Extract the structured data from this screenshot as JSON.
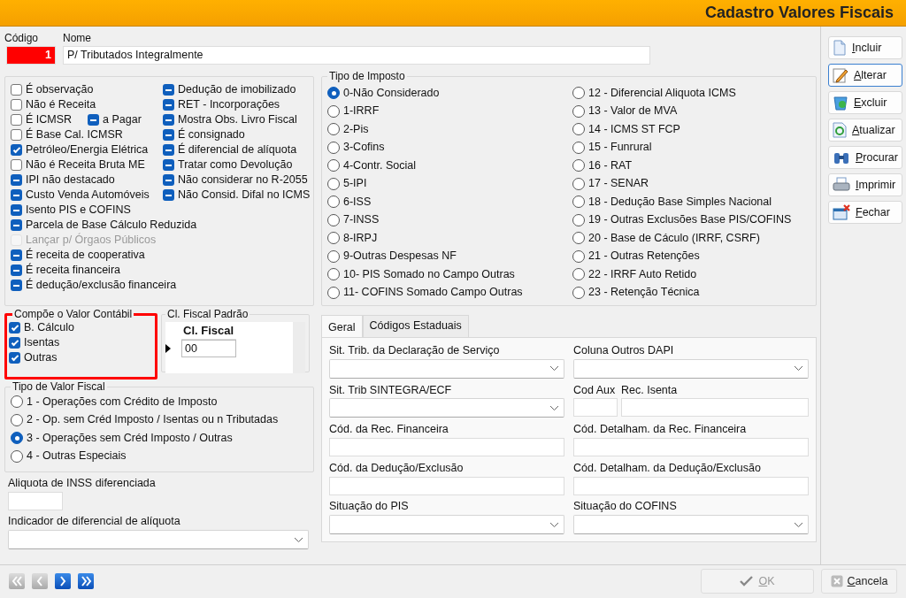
{
  "window": {
    "title": "Cadastro Valores Fiscais"
  },
  "codigo": {
    "label": "Código",
    "value": "1"
  },
  "nome": {
    "label": "Nome",
    "value": "P/ Tributados Integralmente"
  },
  "flags": {
    "column_1": [
      {
        "label": "É observação",
        "checked": false,
        "disabled": false
      },
      {
        "label": "Não é Receita",
        "checked": false,
        "disabled": false
      },
      {
        "label": "É ICMSR",
        "checked": false,
        "disabled": false,
        "inline": {
          "label": "a Pagar",
          "checked": true,
          "indeterminate": true
        }
      },
      {
        "label": "É Base Cal. ICMSR",
        "checked": false,
        "disabled": false
      },
      {
        "label": "Petróleo/Energia Elétrica",
        "checked": true,
        "disabled": false
      },
      {
        "label": "Não é Receita Bruta ME",
        "checked": false,
        "disabled": false
      },
      {
        "label": "IPI não destacado",
        "checked": true,
        "indeterminate": true,
        "disabled": false
      },
      {
        "label": "Custo Venda Automóveis",
        "checked": true,
        "indeterminate": true,
        "disabled": false
      },
      {
        "label": "Isento PIS e COFINS",
        "checked": true,
        "indeterminate": true,
        "disabled": false
      },
      {
        "label": "Parcela de Base Cálculo Reduzida",
        "checked": true,
        "indeterminate": true,
        "disabled": false
      },
      {
        "label": "Lançar p/ Órgaos Públicos",
        "checked": false,
        "disabled": true
      },
      {
        "label": "É receita de cooperativa",
        "checked": true,
        "indeterminate": true,
        "disabled": false
      },
      {
        "label": "É receita financeira",
        "checked": true,
        "indeterminate": true,
        "disabled": false
      },
      {
        "label": "É dedução/exclusão financeira",
        "checked": true,
        "indeterminate": true,
        "disabled": false
      }
    ],
    "column_2": [
      {
        "label": "Dedução de imobilizado",
        "checked": true,
        "indeterminate": true,
        "disabled": false
      },
      {
        "label": "RET - Incorporações",
        "checked": true,
        "indeterminate": true,
        "disabled": false
      },
      {
        "label": "Mostra Obs. Livro Fiscal",
        "checked": true,
        "indeterminate": true,
        "disabled": false
      },
      {
        "label": "É consignado",
        "checked": true,
        "indeterminate": true,
        "disabled": false
      },
      {
        "label": "É diferencial de alíquota",
        "checked": true,
        "indeterminate": true,
        "disabled": false
      },
      {
        "label": "Tratar como Devolução",
        "checked": true,
        "indeterminate": true,
        "disabled": false
      },
      {
        "label": "Não considerar no R-2055",
        "checked": true,
        "indeterminate": true,
        "disabled": false
      },
      {
        "label": "Não Consid. Difal no ICMS",
        "checked": true,
        "indeterminate": true,
        "disabled": false
      }
    ]
  },
  "compoe": {
    "title": "Compõe o Valor Contábil",
    "highlighted": true,
    "items": [
      {
        "label": "B. Cálculo",
        "checked": true
      },
      {
        "label": "Isentas",
        "checked": true
      },
      {
        "label": "Outras",
        "checked": true
      }
    ]
  },
  "cl_fiscal": {
    "title": "Cl. Fiscal Padrão",
    "column": "Cl. Fiscal",
    "rows": [
      {
        "value": "00",
        "current": true
      }
    ]
  },
  "tipo_valor": {
    "title": "Tipo de Valor Fiscal",
    "options": [
      {
        "label": "1 - Operações com Crédito de Imposto",
        "selected": false
      },
      {
        "label": "2 - Op. sem Créd Imposto / Isentas ou n Tributadas",
        "selected": false
      },
      {
        "label": "3 - Operações sem Créd Imposto / Outras",
        "selected": true
      },
      {
        "label": "4 - Outras Especiais",
        "selected": false
      }
    ]
  },
  "aliquota_inss": {
    "label": "Aliquota de INSS diferenciada"
  },
  "indicador": {
    "label": "Indicador de diferencial de alíquota"
  },
  "tipo_imposto": {
    "title": "Tipo de Imposto",
    "options": [
      {
        "label": "0-Não Considerado",
        "selected": true
      },
      {
        "label": "1-IRRF",
        "selected": false
      },
      {
        "label": "2-Pis",
        "selected": false
      },
      {
        "label": "3-Cofins",
        "selected": false
      },
      {
        "label": "4-Contr. Social",
        "selected": false
      },
      {
        "label": "5-IPI",
        "selected": false
      },
      {
        "label": "6-ISS",
        "selected": false
      },
      {
        "label": "7-INSS",
        "selected": false
      },
      {
        "label": "8-IRPJ",
        "selected": false
      },
      {
        "label": "9-Outras Despesas NF",
        "selected": false
      },
      {
        "label": "10- PIS Somado no Campo Outras",
        "selected": false
      },
      {
        "label": "11- COFINS Somado Campo Outras",
        "selected": false
      },
      {
        "label": "12 - Diferencial Aliquota ICMS",
        "selected": false
      },
      {
        "label": "13 - Valor de MVA",
        "selected": false
      },
      {
        "label": "14 - ICMS ST FCP",
        "selected": false
      },
      {
        "label": "15 - Funrural",
        "selected": false
      },
      {
        "label": "16 - RAT",
        "selected": false
      },
      {
        "label": "17 - SENAR",
        "selected": false
      },
      {
        "label": "18 - Dedução Base Simples Nacional",
        "selected": false
      },
      {
        "label": "19 - Outras Exclusões Base PIS/COFINS",
        "selected": false
      },
      {
        "label": "20 - Base de Cáculo (IRRF, CSRF)",
        "selected": false
      },
      {
        "label": "21 - Outras Retenções",
        "selected": false
      },
      {
        "label": "22 - IRRF Auto Retido",
        "selected": false
      },
      {
        "label": "23 - Retenção Técnica",
        "selected": false
      }
    ]
  },
  "tabs": [
    {
      "label": "Geral",
      "selected": true
    },
    {
      "label": "Códigos Estaduais",
      "selected": false
    }
  ],
  "tab_fields": [
    {
      "label": "Sit. Trib. da Declaração de Serviço",
      "kind": "select"
    },
    {
      "label": "Coluna Outros DAPI",
      "kind": "select"
    },
    {
      "label": "Sit. Trib SINTEGRA/ECF",
      "kind": "select"
    },
    {
      "kind": "pair",
      "parts": [
        {
          "label": "Cod Aux"
        },
        {
          "label": "Rec. Isenta"
        }
      ]
    },
    {
      "label": "Cód. da  Rec. Financeira",
      "kind": "text"
    },
    {
      "label": "Cód. Detalham. da Rec. Financeira",
      "kind": "text"
    },
    {
      "label": "Cód. da  Dedução/Exclusão",
      "kind": "text"
    },
    {
      "label": "Cód. Detalham. da Dedução/Exclusão",
      "kind": "text"
    },
    {
      "label": "Situação do PIS",
      "kind": "select"
    },
    {
      "label": "Situação do COFINS",
      "kind": "select"
    }
  ],
  "side_buttons": [
    {
      "label": "Incluir",
      "kind": "new",
      "focused": false
    },
    {
      "label": "Alterar",
      "kind": "edit",
      "focused": true
    },
    {
      "label": "Excluir",
      "kind": "delete",
      "focused": false
    },
    {
      "label": "Atualizar",
      "kind": "refresh",
      "focused": false
    },
    {
      "label": "Procurar",
      "kind": "find",
      "focused": false
    },
    {
      "label": "Imprimir",
      "kind": "print",
      "focused": false
    },
    {
      "label": "Fechar",
      "kind": "close",
      "focused": false
    }
  ],
  "nav_buttons": [
    {
      "kind": "first",
      "disabled": true
    },
    {
      "kind": "previous",
      "disabled": true
    },
    {
      "kind": "next",
      "disabled": false
    },
    {
      "kind": "last",
      "disabled": false
    }
  ],
  "footer_buttons": [
    {
      "label": "OK",
      "kind": "ok",
      "disabled": true
    },
    {
      "label": "Cancela",
      "kind": "cancel",
      "disabled": false
    }
  ]
}
